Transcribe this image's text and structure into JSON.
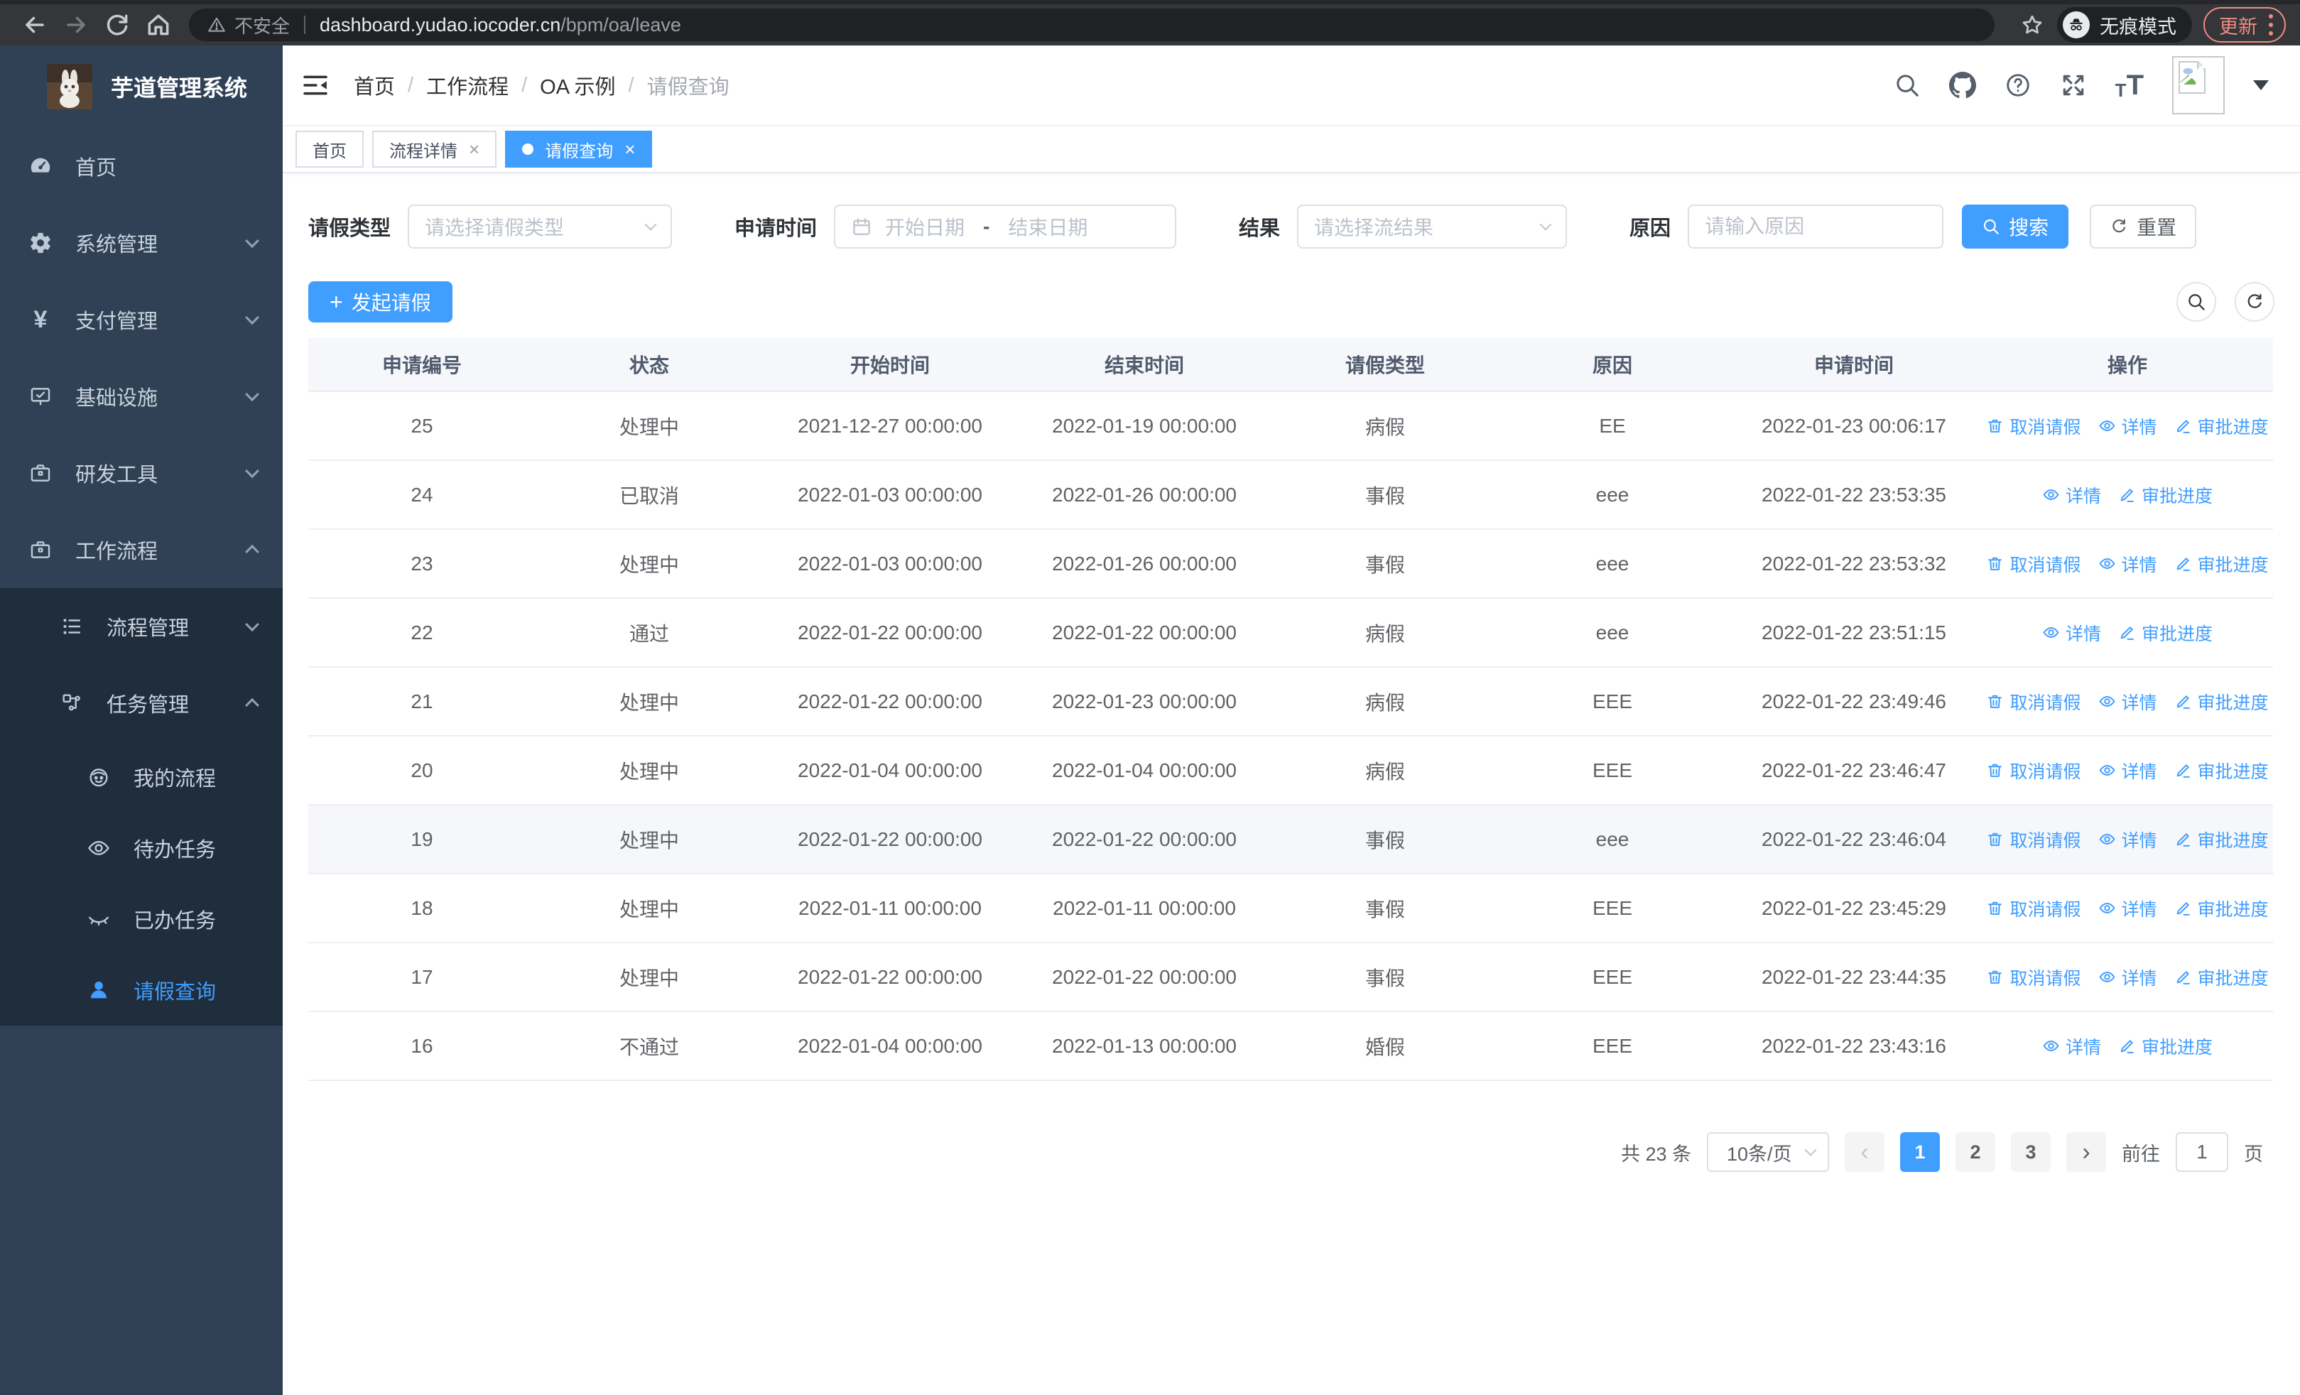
{
  "browser": {
    "security_label": "不安全",
    "url_host": "dashboard.yudao.iocoder.cn",
    "url_path": "/bpm/oa/leave",
    "incognito_label": "无痕模式",
    "update_label": "更新"
  },
  "sidebar": {
    "app_title": "芋道管理系统",
    "items": [
      {
        "label": "首页"
      },
      {
        "label": "系统管理"
      },
      {
        "label": "支付管理"
      },
      {
        "label": "基础设施"
      },
      {
        "label": "研发工具"
      },
      {
        "label": "工作流程"
      }
    ],
    "submenu": [
      {
        "label": "流程管理"
      },
      {
        "label": "任务管理"
      },
      {
        "label": "我的流程"
      },
      {
        "label": "待办任务"
      },
      {
        "label": "已办任务"
      },
      {
        "label": "请假查询"
      }
    ]
  },
  "header": {
    "breadcrumb": [
      "首页",
      "工作流程",
      "OA 示例",
      "请假查询"
    ],
    "separator": "/"
  },
  "tabs": [
    {
      "label": "首页",
      "closable": false,
      "active": false
    },
    {
      "label": "流程详情",
      "closable": true,
      "active": false
    },
    {
      "label": "请假查询",
      "closable": true,
      "active": true
    }
  ],
  "filters": {
    "leave_type_label": "请假类型",
    "leave_type_placeholder": "请选择请假类型",
    "apply_time_label": "申请时间",
    "date_start_placeholder": "开始日期",
    "date_separator": "-",
    "date_end_placeholder": "结束日期",
    "result_label": "结果",
    "result_placeholder": "请选择流结果",
    "reason_label": "原因",
    "reason_placeholder": "请输入原因",
    "search_label": "搜索",
    "reset_label": "重置"
  },
  "toolbar": {
    "create_label": "发起请假"
  },
  "table": {
    "columns": [
      "申请编号",
      "状态",
      "开始时间",
      "结束时间",
      "请假类型",
      "原因",
      "申请时间",
      "操作"
    ],
    "action_labels": {
      "cancel": "取消请假",
      "detail": "详情",
      "progress": "审批进度"
    },
    "rows": [
      {
        "id": "25",
        "status": "处理中",
        "start": "2021-12-27 00:00:00",
        "end": "2022-01-19 00:00:00",
        "type": "病假",
        "reason": "EE",
        "applied": "2022-01-23 00:06:17",
        "actions": [
          "cancel",
          "detail",
          "progress"
        ],
        "highlight": false
      },
      {
        "id": "24",
        "status": "已取消",
        "start": "2022-01-03 00:00:00",
        "end": "2022-01-26 00:00:00",
        "type": "事假",
        "reason": "eee",
        "applied": "2022-01-22 23:53:35",
        "actions": [
          "detail",
          "progress"
        ],
        "highlight": false
      },
      {
        "id": "23",
        "status": "处理中",
        "start": "2022-01-03 00:00:00",
        "end": "2022-01-26 00:00:00",
        "type": "事假",
        "reason": "eee",
        "applied": "2022-01-22 23:53:32",
        "actions": [
          "cancel",
          "detail",
          "progress"
        ],
        "highlight": false
      },
      {
        "id": "22",
        "status": "通过",
        "start": "2022-01-22 00:00:00",
        "end": "2022-01-22 00:00:00",
        "type": "病假",
        "reason": "eee",
        "applied": "2022-01-22 23:51:15",
        "actions": [
          "detail",
          "progress"
        ],
        "highlight": false
      },
      {
        "id": "21",
        "status": "处理中",
        "start": "2022-01-22 00:00:00",
        "end": "2022-01-23 00:00:00",
        "type": "病假",
        "reason": "EEE",
        "applied": "2022-01-22 23:49:46",
        "actions": [
          "cancel",
          "detail",
          "progress"
        ],
        "highlight": false
      },
      {
        "id": "20",
        "status": "处理中",
        "start": "2022-01-04 00:00:00",
        "end": "2022-01-04 00:00:00",
        "type": "病假",
        "reason": "EEE",
        "applied": "2022-01-22 23:46:47",
        "actions": [
          "cancel",
          "detail",
          "progress"
        ],
        "highlight": false
      },
      {
        "id": "19",
        "status": "处理中",
        "start": "2022-01-22 00:00:00",
        "end": "2022-01-22 00:00:00",
        "type": "事假",
        "reason": "eee",
        "applied": "2022-01-22 23:46:04",
        "actions": [
          "cancel",
          "detail",
          "progress"
        ],
        "highlight": true
      },
      {
        "id": "18",
        "status": "处理中",
        "start": "2022-01-11 00:00:00",
        "end": "2022-01-11 00:00:00",
        "type": "事假",
        "reason": "EEE",
        "applied": "2022-01-22 23:45:29",
        "actions": [
          "cancel",
          "detail",
          "progress"
        ],
        "highlight": false
      },
      {
        "id": "17",
        "status": "处理中",
        "start": "2022-01-22 00:00:00",
        "end": "2022-01-22 00:00:00",
        "type": "事假",
        "reason": "EEE",
        "applied": "2022-01-22 23:44:35",
        "actions": [
          "cancel",
          "detail",
          "progress"
        ],
        "highlight": false
      },
      {
        "id": "16",
        "status": "不通过",
        "start": "2022-01-04 00:00:00",
        "end": "2022-01-13 00:00:00",
        "type": "婚假",
        "reason": "EEE",
        "applied": "2022-01-22 23:43:16",
        "actions": [
          "detail",
          "progress"
        ],
        "highlight": false
      }
    ]
  },
  "pagination": {
    "total_label": "共 23 条",
    "page_size_label": "10条/页",
    "pages": [
      "1",
      "2",
      "3"
    ],
    "active_page": "1",
    "goto_label": "前往",
    "goto_value": "1",
    "page_unit": "页"
  },
  "colors": {
    "primary": "#409eff",
    "sidebar_bg": "#304156",
    "submenu_bg": "#1f2d3d",
    "update_accent": "#f28b82"
  }
}
